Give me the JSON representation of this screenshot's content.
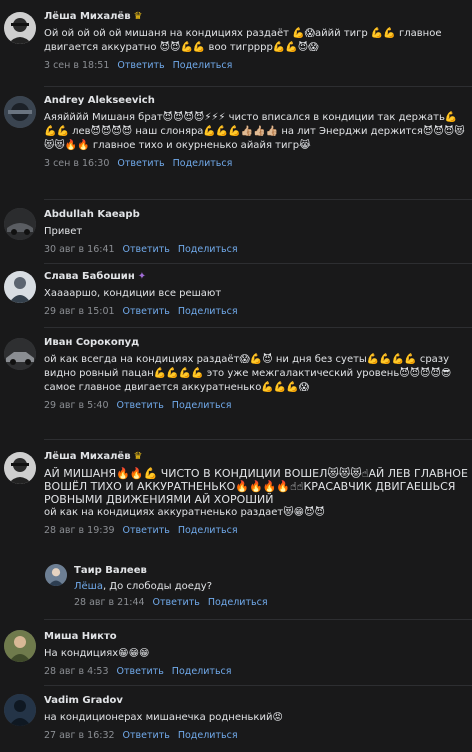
{
  "actions": {
    "reply": "Ответить",
    "share": "Поделиться"
  },
  "comments": [
    {
      "author": "Лёша Михалёв",
      "badge": "♛",
      "text": "Ой ой ой ой ой мишаня на кондициях раздаёт 💪😱аййй тигр 💪💪 главное двигается аккуратно 😈😈💪💪 воо тигрррр💪💪😈😱",
      "date": "3 сен в 18:51"
    },
    {
      "author": "Andrey Alekseevich",
      "badge": "",
      "text": "Аяяйййй Мишаня брат😈😈😈😈⚡⚡⚡ чисто вписался в кондиции так держать💪💪💪 лев😈😈😈😈 наш слоняра💪💪💪👍🏼👍🏼👍🏼 на лит Энерджи держится😈😈😈😻😻😻🔥🔥 главное тихо и окурненько айайя тигр😹",
      "date": "3 сен в 16:30"
    },
    {
      "author": "Abdullah Kaeapb",
      "badge": "",
      "text": "Привет",
      "date": "30 авг в 16:41"
    },
    {
      "author": "Слава Бабошин",
      "badge": "✦",
      "text": "Хааааршо, кондиции все решают",
      "date": "29 авг в 15:01"
    },
    {
      "author": "Иван Сорокопуд",
      "badge": "",
      "text": "ой как всегда на кондициях раздаёт😱💪😈 ни дня без суеты💪💪💪💪 сразу видно ровный пацан💪💪💪💪 это уже межгалактический уровень😈😈😈😈😎 самое главное двигается аккуратненько💪💪💪😱",
      "date": "29 авг в 5:40"
    },
    {
      "author": "Лёша Михалёв",
      "badge": "♛",
      "caps": "АЙ МИШАНЯ🔥🔥💪 ЧИСТО В КОНДИЦИИ ВОШЕЛ😻😻😻☝АЙ ЛЕВ ГЛАВНОЕ ВОШЁЛ ТИХО И АККУРАТНЕНЬКО🔥🔥🔥🔥☝☝КРАСАВЧИК ДВИГАЕШЬСЯ РОВНЫМИ ДВИЖЕНИЯМИ АЙ ХОРОШИЙ",
      "text": "ой как на кондициях аккуратненько раздает😻😁😈😈",
      "date": "28 авг в 19:39"
    },
    {
      "author": "Таир Валеев",
      "badge": "",
      "mention": "Лёша",
      "text": ", До слободы доеду?",
      "date": "28 авг в 21:44"
    },
    {
      "author": "Миша Никто",
      "badge": "",
      "text": "На кондициях😁😁😁",
      "date": "28 авг в 4:53"
    },
    {
      "author": "Vadim Gradov",
      "badge": "",
      "text": "на кондиционерах мишанечка родненький😡",
      "date": "27 авг в 16:32"
    }
  ]
}
